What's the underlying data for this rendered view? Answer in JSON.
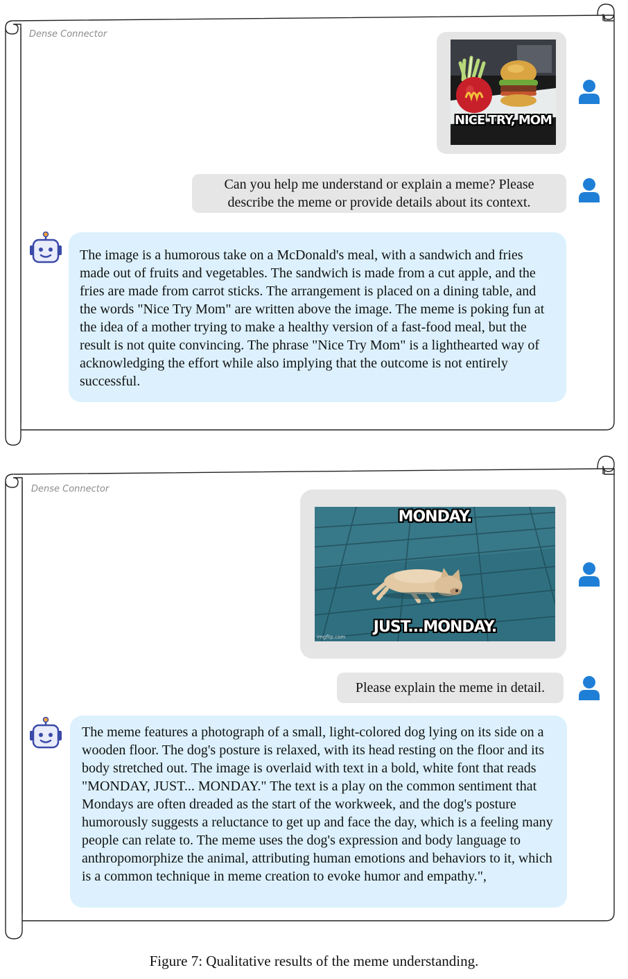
{
  "panels": [
    {
      "label": "Dense Connector",
      "meme": {
        "caption_bottom": "NICE TRY, MOM"
      },
      "question": "Can you help me understand or explain a meme? Please describe the meme or provide details about its context.",
      "answer": "The image is a humorous take on a McDonald's meal, with a sandwich and fries made out of fruits and vegetables. The sandwich is made from a cut apple, and the fries are made from carrot sticks. The arrangement is placed on a dining table, and the words \"Nice Try Mom\" are written above the image. The meme is poking fun at the idea of a mother trying to make a healthy version of a fast-food meal, but the result is not quite convincing. The phrase \"Nice Try Mom\" is a lighthearted way of acknowledging the effort while also implying that the outcome is not entirely successful."
    },
    {
      "label": "Dense Connector",
      "meme": {
        "caption_top": "MONDAY.",
        "caption_bottom": "JUST...MONDAY.",
        "watermark": "imgflip.com"
      },
      "question": "Please explain the meme in detail.",
      "answer": "The meme features a photograph of a small, light-colored dog lying on its side on a wooden floor. The dog's posture is relaxed, with its head resting on the floor and its body stretched out. The image is overlaid with text in a bold, white font that reads \"MONDAY, JUST... MONDAY.\" The text is a play on the common sentiment that Mondays are often dreaded as the start of the workweek, and the dog's posture humorously suggests a reluctance to get up and face the day, which is a feeling many people can relate to. The meme uses the dog's expression and body language to anthropomorphize the animal, attributing human emotions and behaviors to it, which is a common technique in meme creation to evoke humor and empathy.\","
    }
  ],
  "caption": "Figure 7: Qualitative results of the meme understanding.",
  "colors": {
    "question_bubble": "#e6e6e6",
    "answer_bubble": "#dcf1fd",
    "user_icon": "#1f7fd6",
    "bot_icon": "#3b4aa8"
  }
}
